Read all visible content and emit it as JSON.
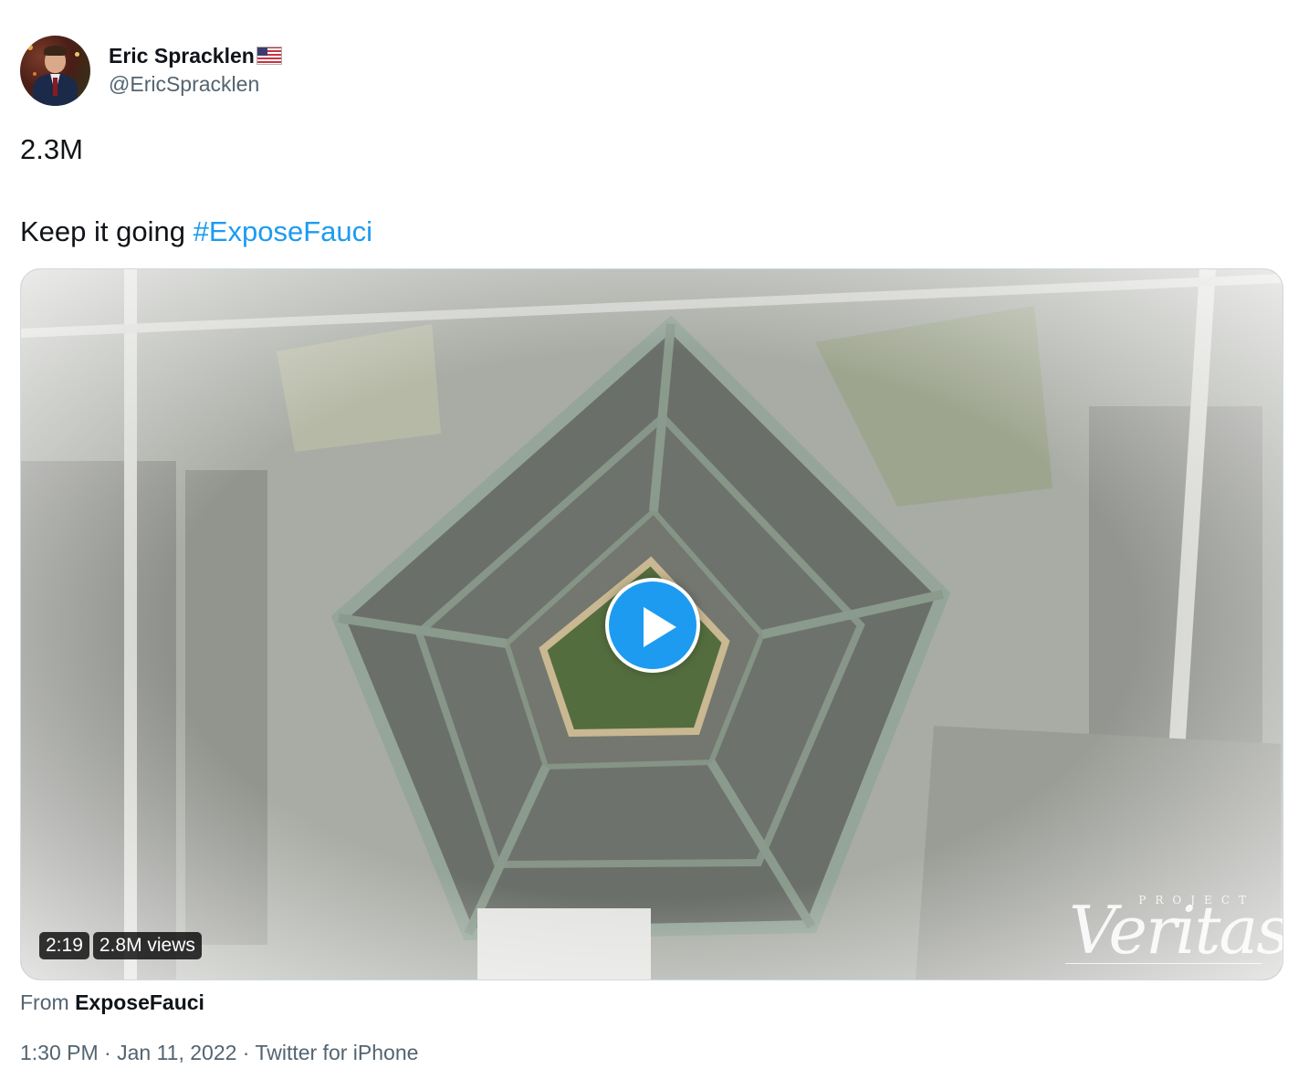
{
  "author": {
    "display_name": "Eric Spracklen",
    "handle": "@EricSpracklen",
    "flag": "us-flag-icon"
  },
  "tweet": {
    "line1": "2.3M",
    "line2_prefix": "Keep it going ",
    "hashtag": "#ExposeFauci"
  },
  "media": {
    "duration": "2:19",
    "views": "2.8M views",
    "watermark_top": "PROJECT",
    "watermark_main": "Veritas"
  },
  "source": {
    "prefix": "From ",
    "name": "ExposeFauci"
  },
  "meta": {
    "time": "1:30 PM",
    "separator": " · ",
    "date": "Jan 11, 2022",
    "client": "Twitter for iPhone"
  },
  "colors": {
    "link": "#1d9bf0",
    "secondary_text": "#536471",
    "primary_text": "#0f1419"
  }
}
